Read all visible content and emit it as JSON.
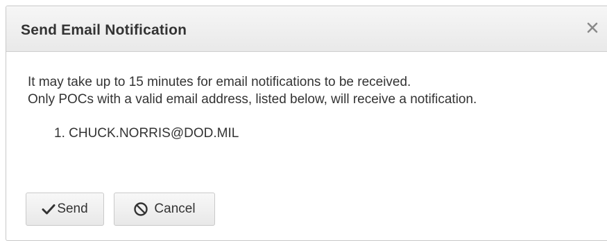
{
  "dialog": {
    "title": "Send Email Notification",
    "close_icon": "close-icon",
    "messages": [
      "It may take up to 15 minutes for email notifications to be received.",
      "Only POCs with a valid email address, listed below, will receive a notification."
    ],
    "pocs": [
      "1. CHUCK.NORRIS@DOD.MIL"
    ],
    "buttons": {
      "send_label": "Send",
      "send_icon": "checkmark-icon",
      "cancel_label": "Cancel",
      "cancel_icon": "ban-icon"
    }
  }
}
